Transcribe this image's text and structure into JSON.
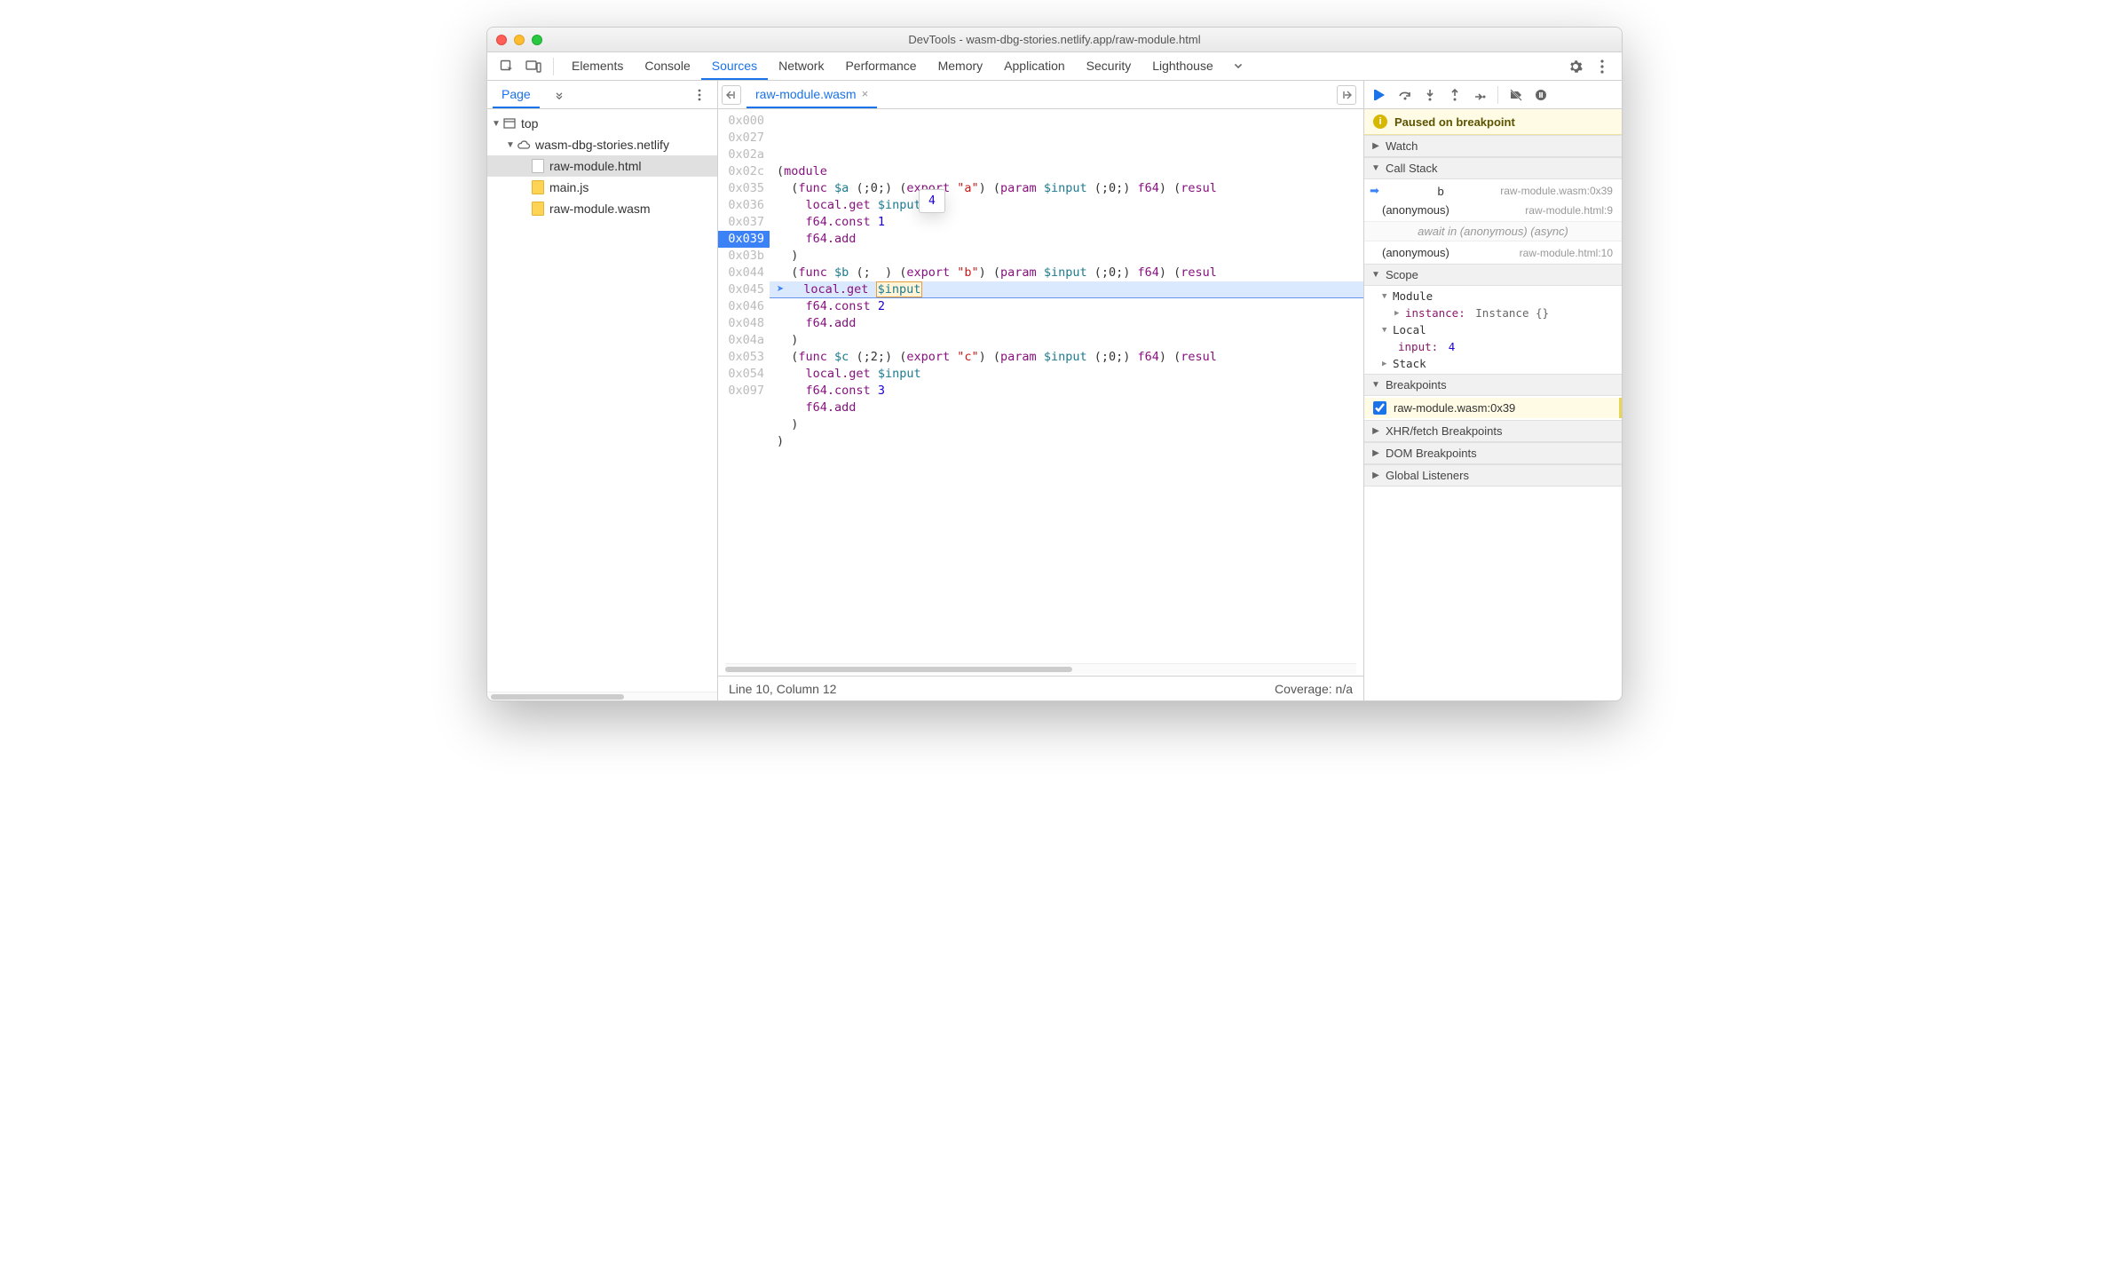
{
  "window_title": "DevTools - wasm-dbg-stories.netlify.app/raw-module.html",
  "main_tabs": [
    "Elements",
    "Console",
    "Sources",
    "Network",
    "Performance",
    "Memory",
    "Application",
    "Security",
    "Lighthouse"
  ],
  "active_main_tab": "Sources",
  "left_nav_tab": "Page",
  "file_tree": {
    "root": "top",
    "domain": "wasm-dbg-stories.netlify",
    "files": [
      "raw-module.html",
      "main.js",
      "raw-module.wasm"
    ],
    "selected": "raw-module.html"
  },
  "open_file": "raw-module.wasm",
  "code": {
    "offsets": [
      "0x000",
      "0x027",
      "0x02a",
      "0x02c",
      "0x035",
      "0x036",
      "0x037",
      "0x039",
      "0x03b",
      "0x044",
      "0x045",
      "0x046",
      "0x048",
      "0x04a",
      "0x053",
      "0x054",
      "0x097"
    ],
    "highlight_index": 7,
    "tooltip_value": "4",
    "lines_html": [
      "(<span class='kw'>module</span>",
      "  (<span class='kw'>func</span> <span class='id'>$a</span> (;0;) (<span class='kw'>export</span> <span class='str'>\"a\"</span>) (<span class='kw'>param</span> <span class='id'>$input</span> (;0;) <span class='kw'>f64</span>) (<span class='kw'>resul</span>",
      "    <span class='kw'>local.get</span> <span class='id'>$input</span>",
      "    <span class='kw'>f64.const</span> <span class='num'>1</span>",
      "    <span class='kw'>f64.add</span>",
      "  )",
      "  (<span class='kw'>func</span> <span class='id'>$b</span> (;&nbsp;&nbsp;) (<span class='kw'>export</span> <span class='str'>\"b\"</span>) (<span class='kw'>param</span> <span class='id'>$input</span> (;0;) <span class='kw'>f64</span>) (<span class='kw'>resul</span>",
      "    <span class='kw'>local.get</span> <span class='id tok-input'>$input</span>",
      "    <span class='kw'>f64.const</span> <span class='num'>2</span>",
      "    <span class='kw'>f64.add</span>",
      "  )",
      "  (<span class='kw'>func</span> <span class='id'>$c</span> (;2;) (<span class='kw'>export</span> <span class='str'>\"c\"</span>) (<span class='kw'>param</span> <span class='id'>$input</span> (;0;) <span class='kw'>f64</span>) (<span class='kw'>resul</span>",
      "    <span class='kw'>local.get</span> <span class='id'>$input</span>",
      "    <span class='kw'>f64.const</span> <span class='num'>3</span>",
      "    <span class='kw'>f64.add</span>",
      "  )",
      ")"
    ]
  },
  "status": {
    "cursor": "Line 10, Column 12",
    "coverage": "Coverage: n/a"
  },
  "debugger": {
    "pause_message": "Paused on breakpoint",
    "sections": {
      "watch": "Watch",
      "callstack": "Call Stack",
      "scope": "Scope",
      "breakpoints": "Breakpoints",
      "xhr_bp": "XHR/fetch Breakpoints",
      "dom_bp": "DOM Breakpoints",
      "global_listeners": "Global Listeners"
    },
    "callstack": [
      {
        "name": "b",
        "location": "raw-module.wasm:0x39",
        "current": true
      },
      {
        "name": "(anonymous)",
        "location": "raw-module.html:9"
      },
      {
        "async_label": "await in (anonymous) (async)"
      },
      {
        "name": "(anonymous)",
        "location": "raw-module.html:10"
      }
    ],
    "scope": {
      "module_label": "Module",
      "instance_label": "instance:",
      "instance_value": "Instance {}",
      "local_label": "Local",
      "local_var": "input:",
      "local_val": "4",
      "stack_label": "Stack"
    },
    "breakpoints": [
      {
        "label": "raw-module.wasm:0x39",
        "checked": true
      }
    ]
  }
}
